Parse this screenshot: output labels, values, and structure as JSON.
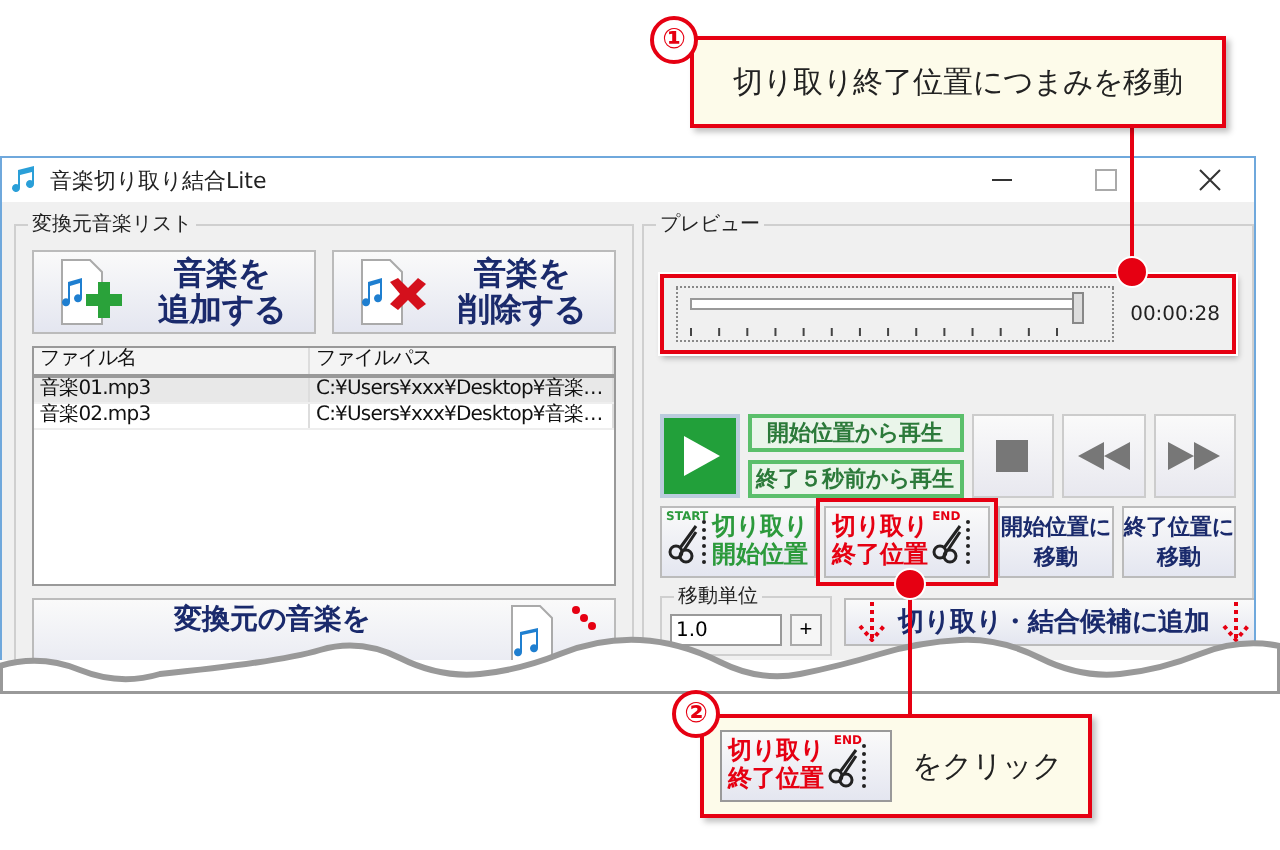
{
  "window": {
    "title": "音楽切り取り結合Lite"
  },
  "source_list": {
    "title": "変換元音楽リスト",
    "buttons": [
      {
        "kind": "add",
        "lines": [
          "音楽を",
          "追加する"
        ]
      },
      {
        "kind": "remove",
        "lines": [
          "音楽を",
          "削除する"
        ]
      }
    ],
    "columns": [
      "ファイル名",
      "ファイルパス"
    ],
    "rows": [
      {
        "cells": [
          "音楽01.mp3",
          "C:¥Users¥xxx¥Desktop¥音楽…"
        ],
        "selected": true
      },
      {
        "cells": [
          "音楽02.mp3",
          "C:¥Users¥xxx¥Desktop¥音楽…"
        ],
        "selected": false
      }
    ],
    "load_button": "変換元の音楽を"
  },
  "preview": {
    "title": "プレビュー",
    "seek": {
      "level": 0.985,
      "time": "00:00:28",
      "highlighted": true
    },
    "play_from": [
      "開始位置から再生",
      "終了５秒前から再生"
    ],
    "cut_buttons": [
      {
        "kind": "start",
        "lines": [
          "切り取り",
          "開始位置"
        ],
        "badge": "START",
        "highlighted": false
      },
      {
        "kind": "end",
        "lines": [
          "切り取り",
          "終了位置"
        ],
        "badge": "END",
        "highlighted": true
      }
    ],
    "move_buttons": [
      {
        "lines": [
          "開始位置に",
          "移動"
        ]
      },
      {
        "lines": [
          "終了位置に",
          "移動"
        ]
      }
    ],
    "step": {
      "title": "移動単位",
      "value": "1.0",
      "plus": "+"
    },
    "add_candidates": "切り取り・結合候補に追加"
  },
  "callouts": [
    {
      "number": "①",
      "text": "切り取り終了位置につまみを移動"
    },
    {
      "number": "②",
      "button": {
        "lines": [
          "切り取り",
          "終了位置"
        ],
        "badge": "END"
      },
      "text": "をクリック"
    }
  ]
}
